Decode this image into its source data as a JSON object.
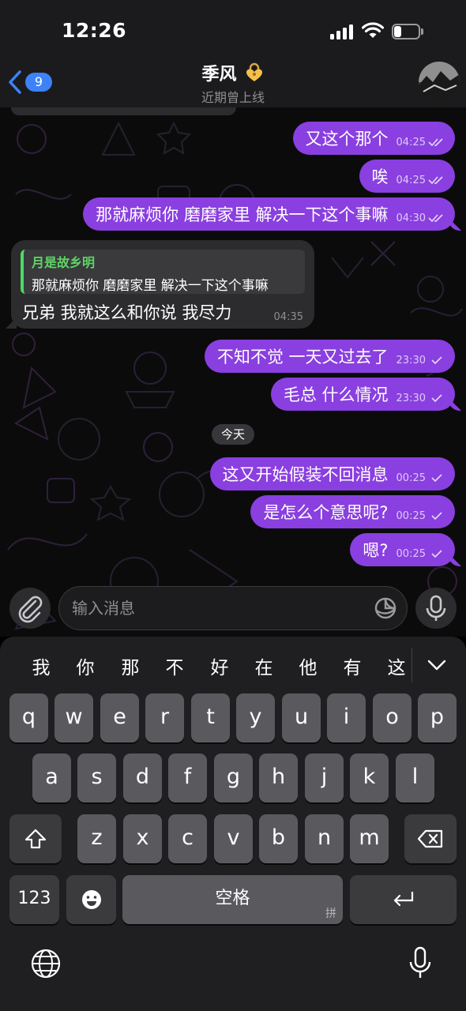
{
  "status_bar": {
    "time": "12:26"
  },
  "nav": {
    "back_badge": "9",
    "title": "季风",
    "status": "近期曾上线"
  },
  "messages": {
    "m1": {
      "text": "又这个那个",
      "time": "04:25"
    },
    "m2": {
      "text": "唉",
      "time": "04:25"
    },
    "m3": {
      "text": "那就麻烦你 磨磨家里 解决一下这个事嘛",
      "time": "04:30"
    },
    "incoming": {
      "reply_author": "月是故乡明",
      "reply_text": "那就麻烦你 磨磨家里 解决一下这个事嘛",
      "text": "兄弟 我就这么和你说 我尽力",
      "time": "04:35"
    },
    "m4": {
      "text": "不知不觉 一天又过去了",
      "time": "23:30"
    },
    "m5": {
      "text": "毛总 什么情况",
      "time": "23:30"
    },
    "date_separator": "今天",
    "m6": {
      "text": "这又开始假装不回消息",
      "time": "00:25"
    },
    "m7": {
      "text": "是怎么个意思呢?",
      "time": "00:25"
    },
    "m8": {
      "text": "嗯?",
      "time": "00:25"
    }
  },
  "input": {
    "placeholder": "输入消息"
  },
  "keyboard": {
    "candidates": [
      "我",
      "你",
      "那",
      "不",
      "好",
      "在",
      "他",
      "有",
      "这"
    ],
    "row1": [
      "q",
      "w",
      "e",
      "r",
      "t",
      "y",
      "u",
      "i",
      "o",
      "p"
    ],
    "row2": [
      "a",
      "s",
      "d",
      "f",
      "g",
      "h",
      "j",
      "k",
      "l"
    ],
    "row3": [
      "z",
      "x",
      "c",
      "v",
      "b",
      "n",
      "m"
    ],
    "numbers_key": "123",
    "space_key": "空格",
    "space_hint": "拼"
  },
  "colors": {
    "outgoing_bubble": "#8a3fe0",
    "incoming_bubble": "#2c2c2e",
    "accent_blue": "#3e82f7",
    "reply_green": "#5ed466"
  },
  "icons": [
    "back-chevron-icon",
    "heart-lock-emoji-icon",
    "double-check-icon",
    "paperclip-icon",
    "sticker-icon",
    "microphone-icon",
    "shift-icon",
    "backspace-icon",
    "emoji-icon",
    "return-icon",
    "globe-icon",
    "dictation-icon",
    "chevron-down-icon"
  ]
}
